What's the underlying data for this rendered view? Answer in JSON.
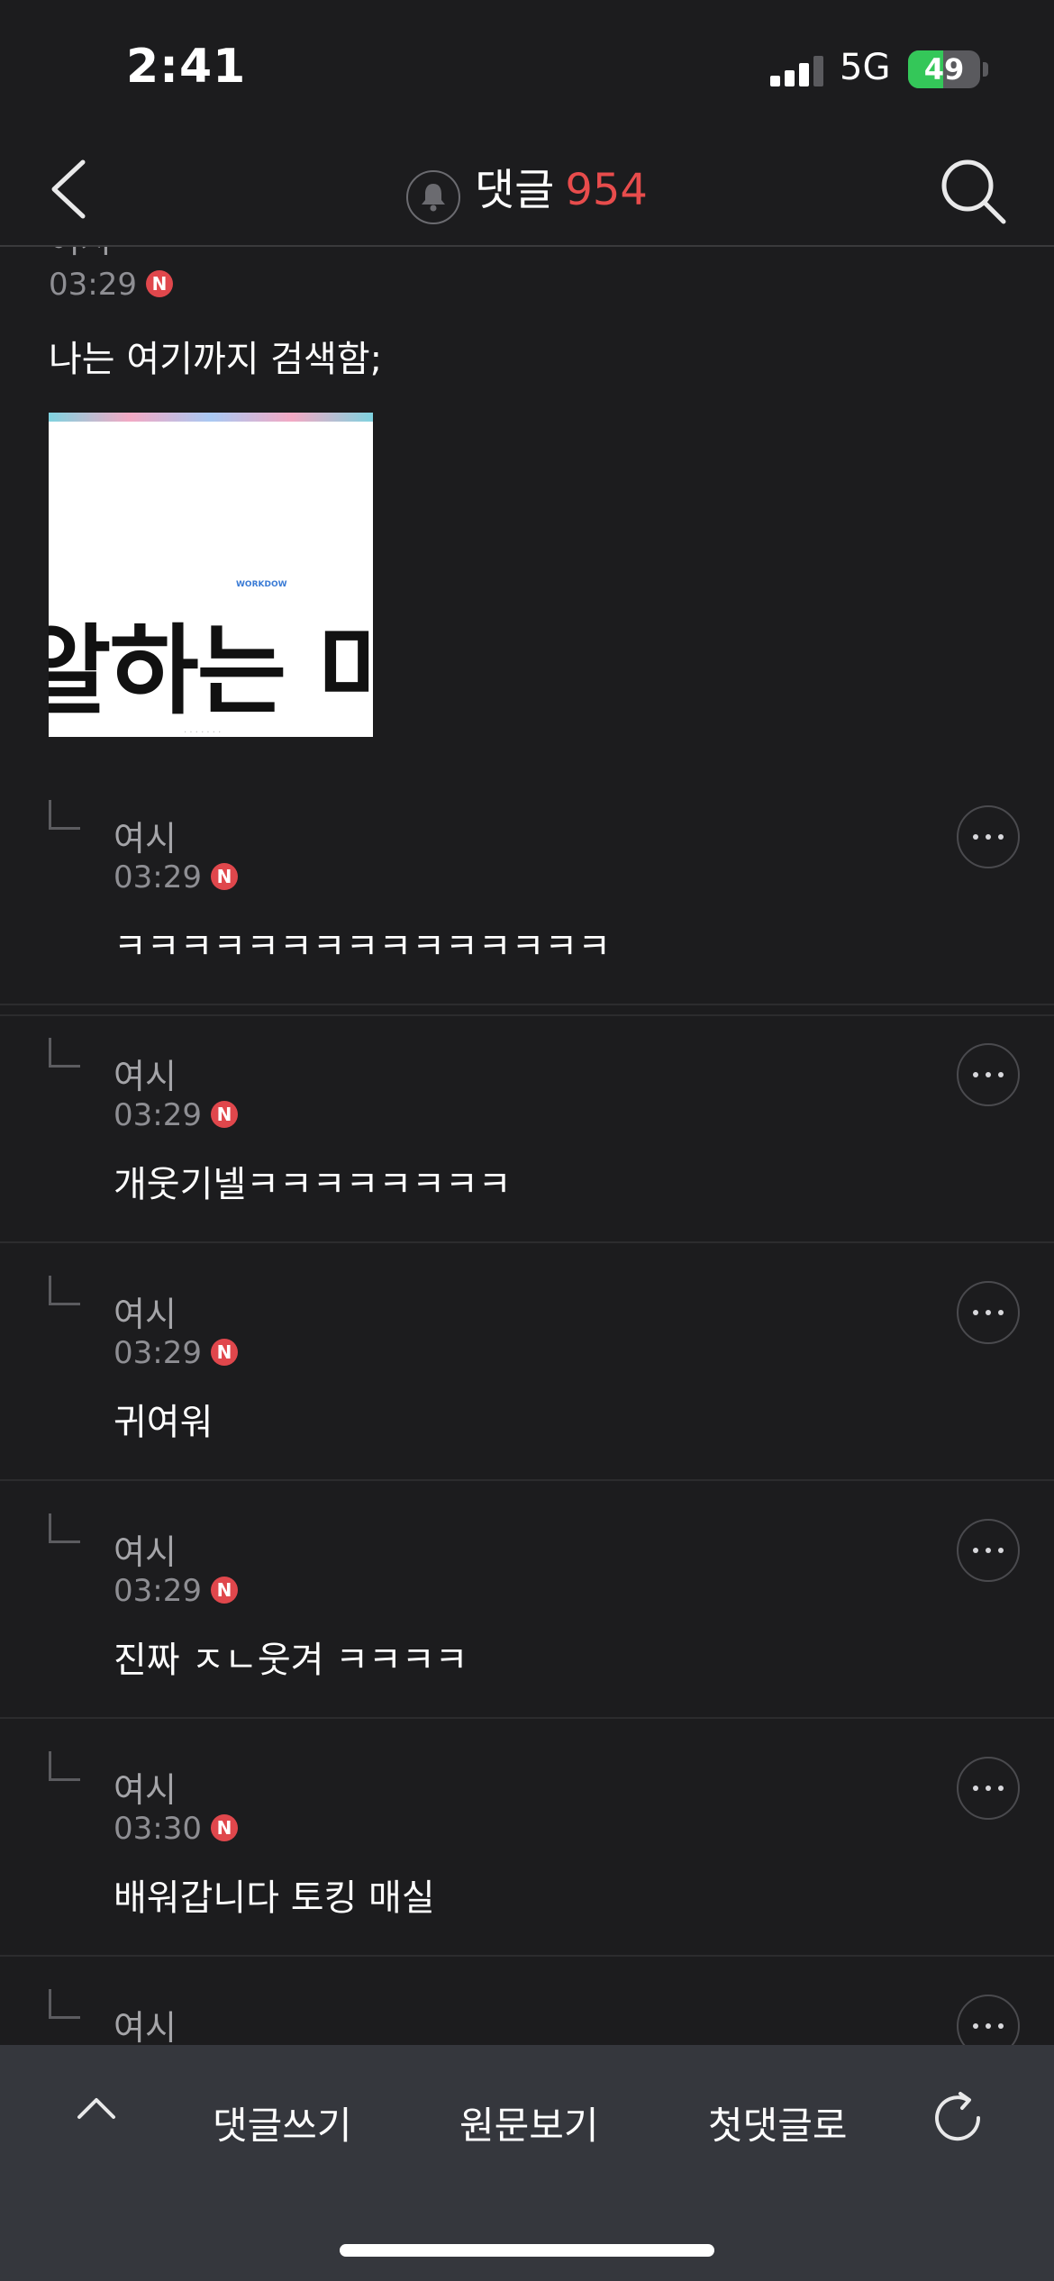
{
  "status_bar": {
    "time": "2:41",
    "network": "5G",
    "battery_level": "49"
  },
  "header": {
    "back_icon": "chevron-left-icon",
    "bell_icon": "bell-icon",
    "title": "댓글",
    "count": "954",
    "count_color": "#e84c4c",
    "search_icon": "search-icon"
  },
  "top_comment": {
    "author_partial": "여시",
    "time": "03:29",
    "badge": "N",
    "text": "나는 여기까지 검색함;",
    "image_text": "알하는 미",
    "image_brand": "WORKDOW"
  },
  "replies": [
    {
      "author": "여시",
      "time": "03:29",
      "badge": "N",
      "text": "ㅋㅋㅋㅋㅋㅋㅋㅋㅋㅋㅋㅋㅋㅋㅋ"
    },
    {
      "author": "여시",
      "time": "03:29",
      "badge": "N",
      "text": "개웃기넬ㅋㅋㅋㅋㅋㅋㅋㅋ"
    },
    {
      "author": "여시",
      "time": "03:29",
      "badge": "N",
      "text": "귀여워"
    },
    {
      "author": "여시",
      "time": "03:29",
      "badge": "N",
      "text": "진짜 ㅈㄴ웃겨 ㅋㅋㅋㅋ"
    },
    {
      "author": "여시",
      "time": "03:30",
      "badge": "N",
      "text": "배워갑니다 토킹 매실"
    },
    {
      "author": "여시",
      "time": "",
      "badge": "",
      "text": ""
    }
  ],
  "bottom_bar": {
    "up_icon": "chevron-up-icon",
    "write_comment": "댓글쓰기",
    "view_original": "원문보기",
    "to_first_comment": "첫댓글로",
    "refresh_icon": "refresh-icon"
  },
  "colors": {
    "background": "#1c1c1e",
    "accent": "#e84c4c",
    "badge": "#e0474c",
    "bottom_bar": "#35373d"
  }
}
